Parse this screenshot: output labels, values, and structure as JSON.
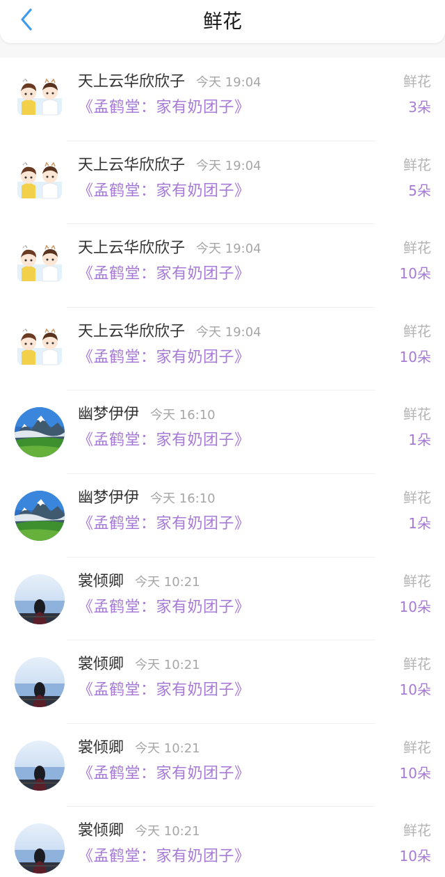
{
  "header": {
    "title": "鲜花",
    "back_icon": "chevron-left-icon",
    "accent_color": "#3d9bf0"
  },
  "colors": {
    "book_purple": "#a67ad6",
    "time_gray": "#a6a6a6"
  },
  "records": [
    {
      "avatar": "cartoon-kids-avatar",
      "user": "天上云华欣欣子",
      "time": "今天 19:04",
      "book": "《孟鹤堂：家有奶团子》",
      "gift": "鲜花",
      "amount": "3朵"
    },
    {
      "avatar": "cartoon-kids-avatar",
      "user": "天上云华欣欣子",
      "time": "今天 19:04",
      "book": "《孟鹤堂：家有奶团子》",
      "gift": "鲜花",
      "amount": "5朵"
    },
    {
      "avatar": "cartoon-kids-avatar",
      "user": "天上云华欣欣子",
      "time": "今天 19:04",
      "book": "《孟鹤堂：家有奶团子》",
      "gift": "鲜花",
      "amount": "10朵"
    },
    {
      "avatar": "cartoon-kids-avatar",
      "user": "天上云华欣欣子",
      "time": "今天 19:04",
      "book": "《孟鹤堂：家有奶团子》",
      "gift": "鲜花",
      "amount": "10朵"
    },
    {
      "avatar": "mountain-landscape-avatar",
      "user": "幽梦伊伊",
      "time": "今天 16:10",
      "book": "《孟鹤堂：家有奶团子》",
      "gift": "鲜花",
      "amount": "1朵"
    },
    {
      "avatar": "mountain-landscape-avatar",
      "user": "幽梦伊伊",
      "time": "今天 16:10",
      "book": "《孟鹤堂：家有奶团子》",
      "gift": "鲜花",
      "amount": "1朵"
    },
    {
      "avatar": "girl-by-sea-avatar",
      "user": "裳倾卿",
      "time": "今天 10:21",
      "book": "《孟鹤堂：家有奶团子》",
      "gift": "鲜花",
      "amount": "10朵"
    },
    {
      "avatar": "girl-by-sea-avatar",
      "user": "裳倾卿",
      "time": "今天 10:21",
      "book": "《孟鹤堂：家有奶团子》",
      "gift": "鲜花",
      "amount": "10朵"
    },
    {
      "avatar": "girl-by-sea-avatar",
      "user": "裳倾卿",
      "time": "今天 10:21",
      "book": "《孟鹤堂：家有奶团子》",
      "gift": "鲜花",
      "amount": "10朵"
    },
    {
      "avatar": "girl-by-sea-avatar",
      "user": "裳倾卿",
      "time": "今天 10:21",
      "book": "《孟鹤堂：家有奶团子》",
      "gift": "鲜花",
      "amount": "10朵"
    }
  ]
}
